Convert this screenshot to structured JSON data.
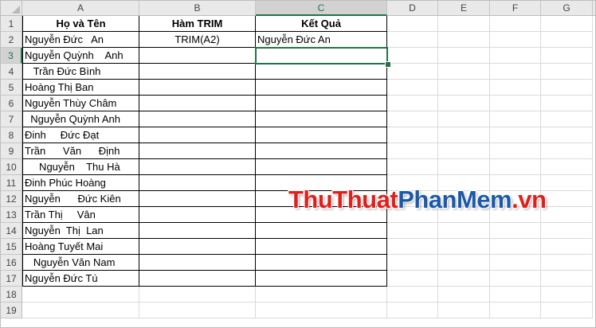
{
  "columns": [
    "A",
    "B",
    "C",
    "D",
    "E",
    "F",
    "G"
  ],
  "rows": [
    "1",
    "2",
    "3",
    "4",
    "5",
    "6",
    "7",
    "8",
    "9",
    "10",
    "11",
    "12",
    "13",
    "14",
    "15",
    "16",
    "17",
    "18",
    "19"
  ],
  "headers": {
    "a": "Họ và Tên",
    "b": "Hàm TRIM",
    "c": "Kết Quả"
  },
  "names": [
    "Nguyễn Đức   An",
    "Nguyễn Quỳnh    Anh",
    "   Trần Đức Bình",
    "Hoàng Thị Ban",
    "Nguyễn Thùy Châm",
    "  Nguyễn Quỳnh Anh",
    "Đinh     Đức Đạt",
    "Trần      Văn      Định",
    "     Nguyễn    Thu Hà",
    "Đinh Phúc Hoàng",
    "Nguyễn      Đức Kiên",
    "Trần Thị     Vân",
    "Nguyễn  Thị  Lan",
    "Hoàng Tuyết Mai",
    "   Nguyễn Văn Nam",
    "Nguyễn Đức Tú"
  ],
  "b2_formula": "TRIM(A2)",
  "c2_result": "Nguyễn Đức An",
  "selected_cell": "C3",
  "watermark": {
    "part1": "ThuThuat",
    "part2": "PhanMem",
    "part3": ".vn"
  }
}
